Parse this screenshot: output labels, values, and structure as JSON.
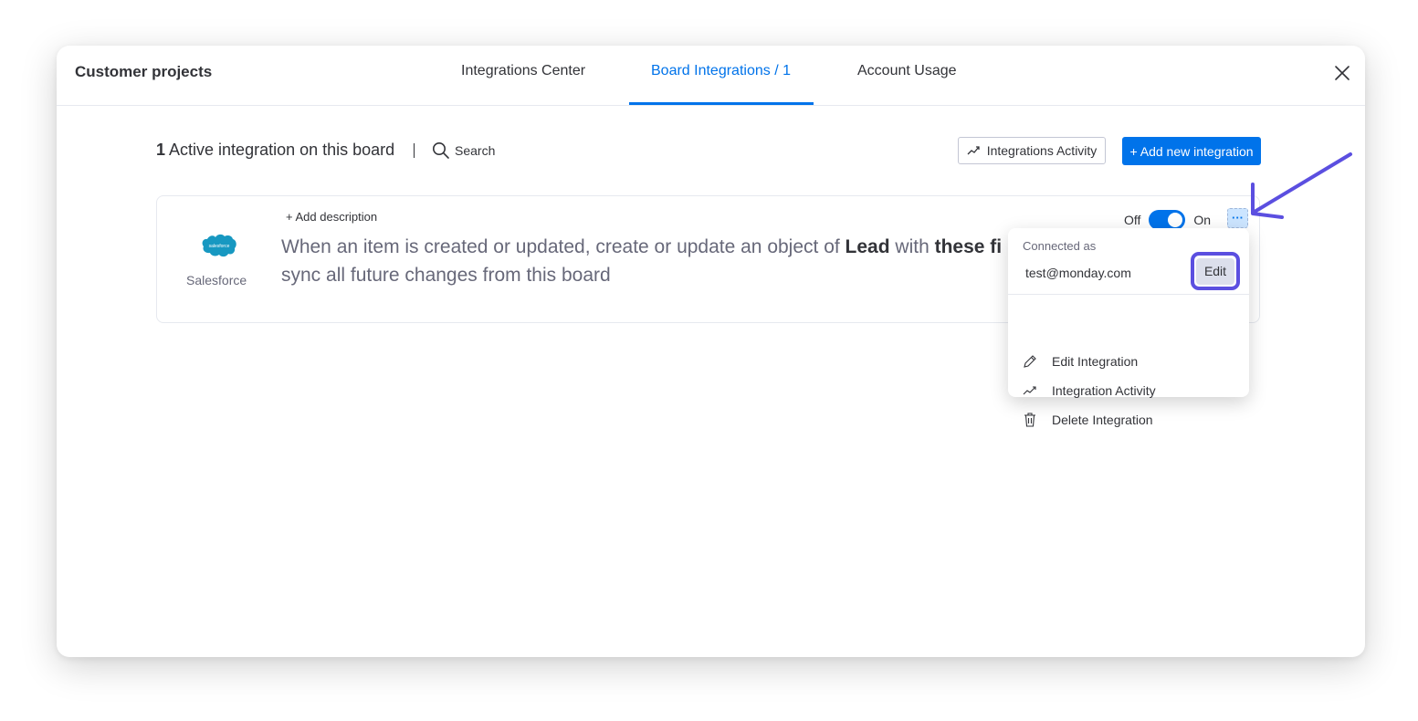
{
  "header": {
    "board_title": "Customer projects",
    "tabs": [
      {
        "label": "Integrations Center",
        "active": false
      },
      {
        "label": "Board Integrations / 1",
        "active": true
      },
      {
        "label": "Account Usage",
        "active": false
      }
    ]
  },
  "toolbar": {
    "count": "1",
    "summary_text": "Active integration on this board",
    "search_label": "Search",
    "activity_label": "Integrations Activity",
    "add_label": "+ Add new integration"
  },
  "integration": {
    "app_name": "Salesforce",
    "logo_text": "salesforce",
    "add_description": "+ Add description",
    "recipe_part1": "When an item is created or updated, create or update an object of ",
    "recipe_bold1": "Lead",
    "recipe_part2": " with ",
    "recipe_bold2": "these fi",
    "recipe_line2": "sync all future changes from this board",
    "toggle_off": "Off",
    "toggle_on": "On",
    "toggle_state": "on",
    "more_label": "···"
  },
  "menu": {
    "connected_as": "Connected as",
    "email": "test@monday.com",
    "edit_label": "Edit",
    "items": [
      {
        "label": "Edit Integration",
        "icon": "pencil-icon"
      },
      {
        "label": "Integration Activity",
        "icon": "activity-icon"
      },
      {
        "label": "Delete Integration",
        "icon": "trash-icon"
      }
    ]
  },
  "colors": {
    "accent": "#0073ea",
    "annotation": "#5b4fe0",
    "salesforce": "#1798c1"
  }
}
